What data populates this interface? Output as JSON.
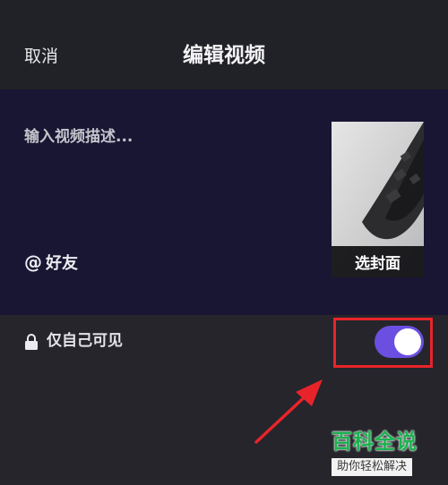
{
  "header": {
    "cancel_label": "取消",
    "title": "编辑视频"
  },
  "editor": {
    "description_placeholder": "输入视频描述...",
    "mention_symbol": "@",
    "mention_label": "好友",
    "cover_button_label": "选封面"
  },
  "privacy": {
    "icon": "lock-icon",
    "label": "仅自己可见",
    "toggle_on": true,
    "toggle_color": "#6b4fe0"
  },
  "annotation": {
    "highlight_color": "#e8242a"
  },
  "watermark": {
    "title": "百科全说",
    "subtitle": "助你轻松解决",
    "color": "#1bb24f"
  }
}
